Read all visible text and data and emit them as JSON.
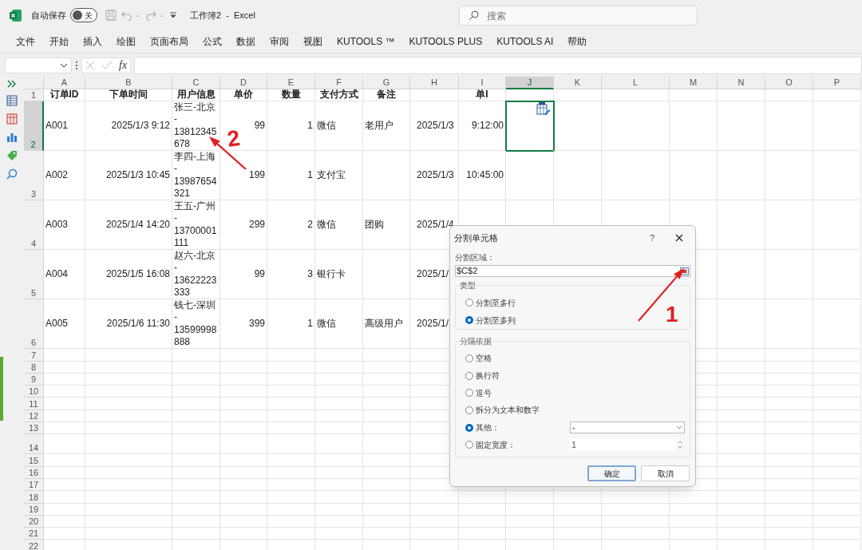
{
  "title_bar": {
    "autosave_label": "自动保存",
    "autosave": {
      "on": false,
      "label": "关"
    },
    "document_title": "工作簿2  -  Excel",
    "search": {
      "placeholder": "搜索"
    }
  },
  "ribbon_tabs": [
    "文件",
    "开始",
    "插入",
    "绘图",
    "页面布局",
    "公式",
    "数据",
    "审阅",
    "视图",
    "KUTOOLS ™",
    "KUTOOLS PLUS",
    "KUTOOLS AI",
    "帮助"
  ],
  "formula_bar": {
    "function_label": "fx"
  },
  "sheet": {
    "columns": [
      {
        "label": "A",
        "selected": false
      },
      {
        "label": "B",
        "selected": false
      },
      {
        "label": "C",
        "selected": false
      },
      {
        "label": "D",
        "selected": false
      },
      {
        "label": "E",
        "selected": false
      },
      {
        "label": "F",
        "selected": false
      },
      {
        "label": "G",
        "selected": false
      },
      {
        "label": "H",
        "selected": false
      },
      {
        "label": "I",
        "selected": false
      },
      {
        "label": "J",
        "selected": true
      },
      {
        "label": "K",
        "selected": false
      },
      {
        "label": "L",
        "selected": false
      },
      {
        "label": "M",
        "selected": false
      },
      {
        "label": "N",
        "selected": false
      },
      {
        "label": "O",
        "selected": false
      },
      {
        "label": "P",
        "selected": false
      }
    ],
    "rows": [
      {
        "label": "1",
        "selected": false,
        "cells": {
          "A": "订单ID",
          "B": "下单时间",
          "C": "用户信息",
          "D": "单价",
          "E": "数量",
          "F": "支付方式",
          "G": "备注",
          "I": "单I"
        }
      },
      {
        "label": "2",
        "selected": true,
        "cells": {
          "A": "A001",
          "B": "2025/1/3 9:12",
          "C": "张三-北京\n-\n13812345\n678",
          "D": "99",
          "E": "1",
          "F": "微信",
          "G": "老用户",
          "H": "2025/1/3",
          "I": "9:12:00"
        }
      },
      {
        "label": "3",
        "selected": false,
        "cells": {
          "A": "A002",
          "B": "2025/1/3 10:45",
          "C": "李四-上海\n-\n13987654\n321",
          "D": "199",
          "E": "1",
          "F": "支付宝",
          "H": "2025/1/3",
          "I": "10:45:00"
        }
      },
      {
        "label": "4",
        "selected": false,
        "cells": {
          "A": "A003",
          "B": "2025/1/4 14:20",
          "C": "王五-广州\n-\n13700001\n111",
          "D": "299",
          "E": "2",
          "F": "微信",
          "G": "团购",
          "H": "2025/1/4"
        }
      },
      {
        "label": "5",
        "selected": false,
        "cells": {
          "A": "A004",
          "B": "2025/1/5 16:08",
          "C": "赵六-北京\n-\n13622223\n333",
          "D": "99",
          "E": "3",
          "F": "银行卡",
          "H": "2025/1/"
        }
      },
      {
        "label": "6",
        "selected": false,
        "cells": {
          "A": "A005",
          "B": "2025/1/6 11:30",
          "C": "钱七-深圳\n-\n13599998\n888",
          "D": "399",
          "E": "1",
          "F": "微信",
          "G": "高级用户",
          "H": "2025/1/"
        }
      },
      {
        "label": "7",
        "selected": false,
        "cells": {}
      },
      {
        "label": "8",
        "selected": false,
        "cells": {}
      },
      {
        "label": "9",
        "selected": false,
        "cells": {}
      },
      {
        "label": "10",
        "selected": false,
        "cells": {}
      },
      {
        "label": "11",
        "selected": false,
        "cells": {}
      },
      {
        "label": "12",
        "selected": false,
        "cells": {}
      },
      {
        "label": "13",
        "selected": false,
        "cells": {}
      },
      {
        "label": "14",
        "selected": false,
        "cells": {}
      },
      {
        "label": "15",
        "selected": false,
        "cells": {}
      },
      {
        "label": "16",
        "selected": false,
        "cells": {}
      },
      {
        "label": "17",
        "selected": false,
        "cells": {}
      },
      {
        "label": "18",
        "selected": false,
        "cells": {}
      },
      {
        "label": "19",
        "selected": false,
        "cells": {}
      },
      {
        "label": "20",
        "selected": false,
        "cells": {}
      },
      {
        "label": "21",
        "selected": false,
        "cells": {}
      },
      {
        "label": "22",
        "selected": false,
        "cells": {}
      }
    ]
  },
  "dialog": {
    "title": "分割单元格",
    "help": "?",
    "range": {
      "label": "分割区域：",
      "value": "$C$2"
    },
    "type_group": {
      "title": "类型",
      "options": [
        {
          "label": "分割至多行",
          "selected": false
        },
        {
          "label": "分割至多列",
          "selected": true
        }
      ]
    },
    "separator_group": {
      "title": "分隔依据",
      "options": [
        {
          "label": "空格",
          "selected": false,
          "kind": "plain"
        },
        {
          "label": "换行符",
          "selected": false,
          "kind": "plain"
        },
        {
          "label": "逗号",
          "selected": false,
          "kind": "plain"
        },
        {
          "label": "拆分为文本和数字",
          "selected": false,
          "kind": "plain"
        },
        {
          "label": "其他：",
          "selected": true,
          "kind": "dropdown",
          "value": "-"
        },
        {
          "label": "固定宽度：",
          "selected": false,
          "kind": "spinner",
          "value": "1"
        }
      ]
    },
    "buttons": [
      {
        "label": "确定",
        "default": true
      },
      {
        "label": "取消",
        "default": false
      }
    ]
  },
  "annotations": [
    {
      "kind": "arrow_with_number",
      "number": "2"
    },
    {
      "kind": "arrow_with_number",
      "number": "1"
    }
  ]
}
